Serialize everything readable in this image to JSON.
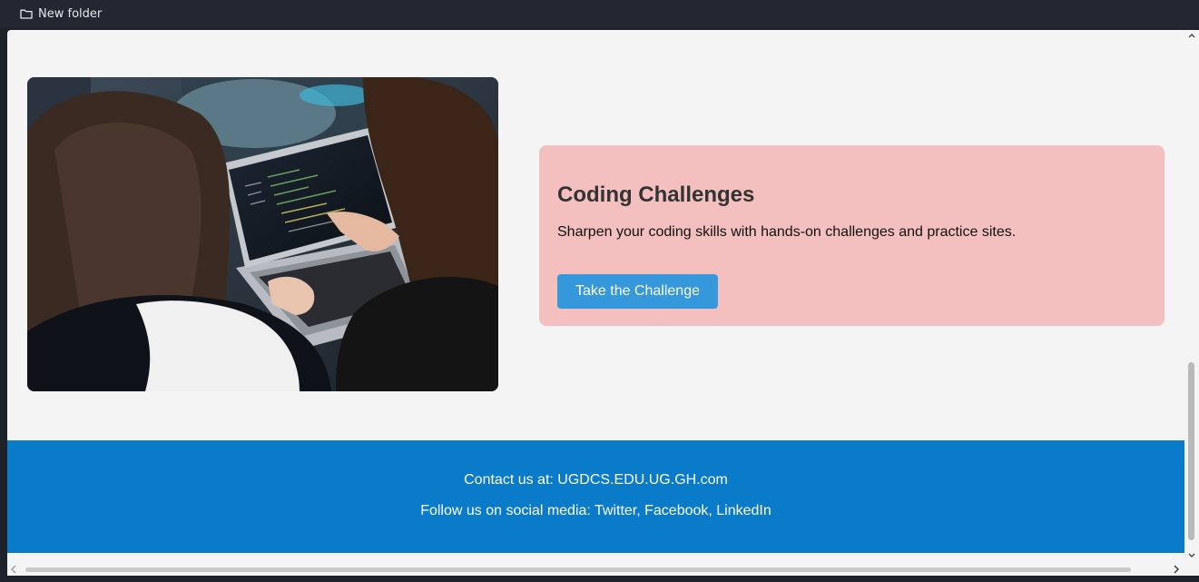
{
  "bookmarks_bar": {
    "items": [
      {
        "label": "New folder",
        "icon": "folder-icon"
      }
    ]
  },
  "content_section": {
    "image": {
      "description_icon": "image-photo",
      "alt": ""
    },
    "card": {
      "title": "Coding Challenges",
      "text": "Sharpen your coding skills with hands-on challenges and practice sites.",
      "button_label": "Take the Challenge",
      "background_color": "#f3bfbf",
      "button_color": "#3498db"
    }
  },
  "footer": {
    "contact_text": "Contact us at: UGDCS.EDU.UG.GH.com",
    "social_text": "Follow us on social media: Twitter, Facebook, LinkedIn",
    "background_color": "#0a7bc8"
  },
  "scrollbars": {
    "vertical": {
      "up_icon": "chevron-up-icon",
      "down_icon": "chevron-down-icon"
    },
    "horizontal": {
      "left_icon": "chevron-left-icon",
      "right_icon": "chevron-right-icon"
    }
  }
}
